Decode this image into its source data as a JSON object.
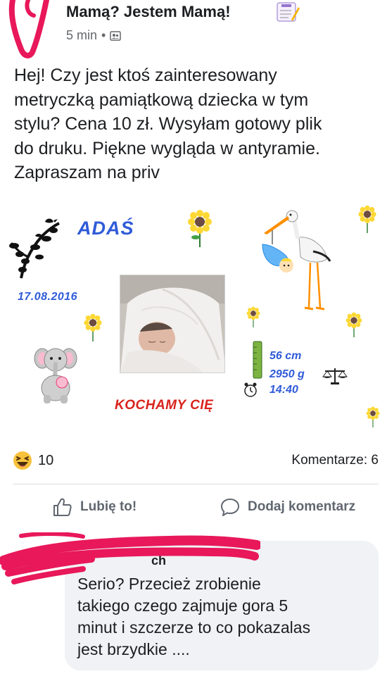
{
  "post": {
    "group_name": "Mamą? Jestem Mamą!",
    "time": "5 min",
    "separator": "•",
    "text": "Hej! Czy jest ktoś zainteresowany\nmetryczką pamiątkową dziecka w tym\nstylu? Cena 10 zł. Wysyłam gotowy plik\ndo druku. Piękne wygląda w antyramie.\nZapraszam na priv"
  },
  "card": {
    "baby_name": "ADAŚ",
    "birth_date": "17.08.2016",
    "length": "56 cm",
    "weight": "2950 g",
    "time": "14:40",
    "love_text": "KOCHAMY CIĘ"
  },
  "stats": {
    "reactions_count": "10",
    "comments_label": "Komentarze: 6"
  },
  "actions": {
    "like_label": "Lubię to!",
    "comment_label": "Dodaj komentarz"
  },
  "comment": {
    "author_fragment": "ch",
    "text": "Serio? Przecież zrobienie\ntakiego czego zajmuje gora 5\nminut i szczerze to co pokazalas\njest brzydkie ...."
  },
  "colors": {
    "accent_blue": "#2f5bd8",
    "accent_red": "#d9221c",
    "scribble_pink": "#e8185a",
    "muted_text": "#65676b"
  },
  "icons": {
    "group_audience": "group-icon",
    "reaction": "haha-icon",
    "like": "thumbs-up-icon",
    "comment": "comment-icon"
  }
}
